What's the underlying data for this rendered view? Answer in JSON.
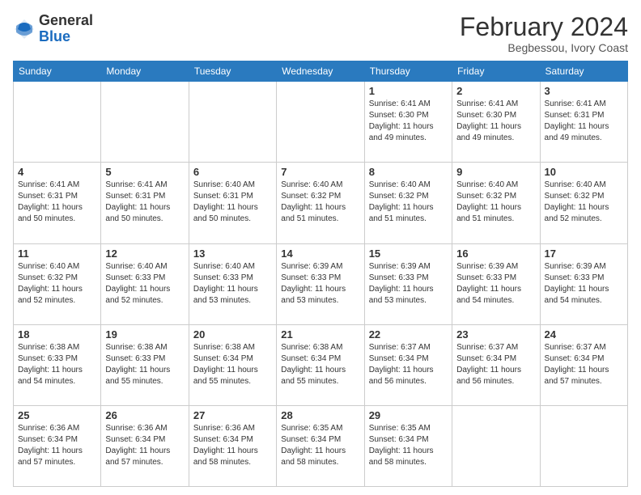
{
  "header": {
    "logo_general": "General",
    "logo_blue": "Blue",
    "month_year": "February 2024",
    "location": "Begbessou, Ivory Coast"
  },
  "days_of_week": [
    "Sunday",
    "Monday",
    "Tuesday",
    "Wednesday",
    "Thursday",
    "Friday",
    "Saturday"
  ],
  "weeks": [
    [
      {
        "day": "",
        "info": ""
      },
      {
        "day": "",
        "info": ""
      },
      {
        "day": "",
        "info": ""
      },
      {
        "day": "",
        "info": ""
      },
      {
        "day": "1",
        "info": "Sunrise: 6:41 AM\nSunset: 6:30 PM\nDaylight: 11 hours and 49 minutes."
      },
      {
        "day": "2",
        "info": "Sunrise: 6:41 AM\nSunset: 6:30 PM\nDaylight: 11 hours and 49 minutes."
      },
      {
        "day": "3",
        "info": "Sunrise: 6:41 AM\nSunset: 6:31 PM\nDaylight: 11 hours and 49 minutes."
      }
    ],
    [
      {
        "day": "4",
        "info": "Sunrise: 6:41 AM\nSunset: 6:31 PM\nDaylight: 11 hours and 50 minutes."
      },
      {
        "day": "5",
        "info": "Sunrise: 6:41 AM\nSunset: 6:31 PM\nDaylight: 11 hours and 50 minutes."
      },
      {
        "day": "6",
        "info": "Sunrise: 6:40 AM\nSunset: 6:31 PM\nDaylight: 11 hours and 50 minutes."
      },
      {
        "day": "7",
        "info": "Sunrise: 6:40 AM\nSunset: 6:32 PM\nDaylight: 11 hours and 51 minutes."
      },
      {
        "day": "8",
        "info": "Sunrise: 6:40 AM\nSunset: 6:32 PM\nDaylight: 11 hours and 51 minutes."
      },
      {
        "day": "9",
        "info": "Sunrise: 6:40 AM\nSunset: 6:32 PM\nDaylight: 11 hours and 51 minutes."
      },
      {
        "day": "10",
        "info": "Sunrise: 6:40 AM\nSunset: 6:32 PM\nDaylight: 11 hours and 52 minutes."
      }
    ],
    [
      {
        "day": "11",
        "info": "Sunrise: 6:40 AM\nSunset: 6:32 PM\nDaylight: 11 hours and 52 minutes."
      },
      {
        "day": "12",
        "info": "Sunrise: 6:40 AM\nSunset: 6:33 PM\nDaylight: 11 hours and 52 minutes."
      },
      {
        "day": "13",
        "info": "Sunrise: 6:40 AM\nSunset: 6:33 PM\nDaylight: 11 hours and 53 minutes."
      },
      {
        "day": "14",
        "info": "Sunrise: 6:39 AM\nSunset: 6:33 PM\nDaylight: 11 hours and 53 minutes."
      },
      {
        "day": "15",
        "info": "Sunrise: 6:39 AM\nSunset: 6:33 PM\nDaylight: 11 hours and 53 minutes."
      },
      {
        "day": "16",
        "info": "Sunrise: 6:39 AM\nSunset: 6:33 PM\nDaylight: 11 hours and 54 minutes."
      },
      {
        "day": "17",
        "info": "Sunrise: 6:39 AM\nSunset: 6:33 PM\nDaylight: 11 hours and 54 minutes."
      }
    ],
    [
      {
        "day": "18",
        "info": "Sunrise: 6:38 AM\nSunset: 6:33 PM\nDaylight: 11 hours and 54 minutes."
      },
      {
        "day": "19",
        "info": "Sunrise: 6:38 AM\nSunset: 6:33 PM\nDaylight: 11 hours and 55 minutes."
      },
      {
        "day": "20",
        "info": "Sunrise: 6:38 AM\nSunset: 6:34 PM\nDaylight: 11 hours and 55 minutes."
      },
      {
        "day": "21",
        "info": "Sunrise: 6:38 AM\nSunset: 6:34 PM\nDaylight: 11 hours and 55 minutes."
      },
      {
        "day": "22",
        "info": "Sunrise: 6:37 AM\nSunset: 6:34 PM\nDaylight: 11 hours and 56 minutes."
      },
      {
        "day": "23",
        "info": "Sunrise: 6:37 AM\nSunset: 6:34 PM\nDaylight: 11 hours and 56 minutes."
      },
      {
        "day": "24",
        "info": "Sunrise: 6:37 AM\nSunset: 6:34 PM\nDaylight: 11 hours and 57 minutes."
      }
    ],
    [
      {
        "day": "25",
        "info": "Sunrise: 6:36 AM\nSunset: 6:34 PM\nDaylight: 11 hours and 57 minutes."
      },
      {
        "day": "26",
        "info": "Sunrise: 6:36 AM\nSunset: 6:34 PM\nDaylight: 11 hours and 57 minutes."
      },
      {
        "day": "27",
        "info": "Sunrise: 6:36 AM\nSunset: 6:34 PM\nDaylight: 11 hours and 58 minutes."
      },
      {
        "day": "28",
        "info": "Sunrise: 6:35 AM\nSunset: 6:34 PM\nDaylight: 11 hours and 58 minutes."
      },
      {
        "day": "29",
        "info": "Sunrise: 6:35 AM\nSunset: 6:34 PM\nDaylight: 11 hours and 58 minutes."
      },
      {
        "day": "",
        "info": ""
      },
      {
        "day": "",
        "info": ""
      }
    ]
  ]
}
